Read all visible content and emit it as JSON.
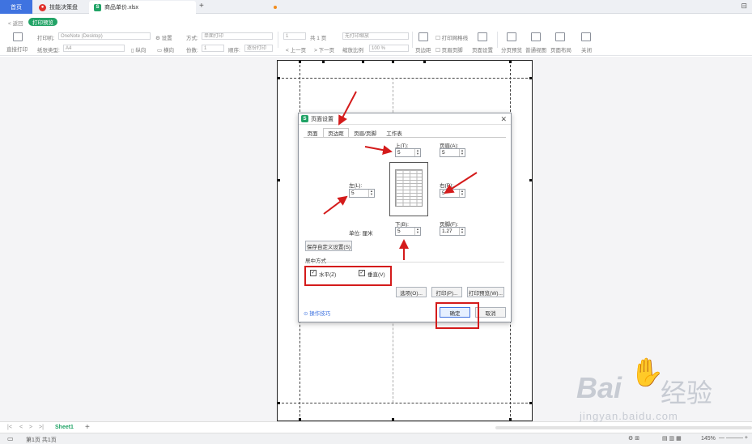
{
  "tabs": {
    "home": "首页",
    "doc1": "技能决策盘",
    "doc2": "商品单价.xlsx"
  },
  "toolbar": {
    "back": "< 返回",
    "mode_tag": "打印预览",
    "direct_print": "直接打印",
    "printer_label": "打印机:",
    "printer_value": "OneNote (Desktop)",
    "settings": "设置",
    "paper_type_label": "纸张类型:",
    "paper_type_value": "A4",
    "portrait": "纵向",
    "landscape": "横向",
    "method_label": "方式:",
    "method_value": "单面打印",
    "copies_label": "份数:",
    "copies_value": "1",
    "order_label": "顺序:",
    "order_value": "逐份打印",
    "page_value": "1",
    "page_total": "共 1 页",
    "prev": "上一页",
    "next": "下一页",
    "scale_value": "无打印缩放",
    "zoom_label": "缩放比例",
    "zoom_value": "100 %",
    "margins_btn": "页边距",
    "print_gridlines": "打印网格线",
    "header_footer": "页眉页脚",
    "page_setup": "页面设置",
    "page_break": "分页预览",
    "normal_view": "普通视图",
    "page_layout": "页面布局",
    "close": "关闭"
  },
  "dialog": {
    "title": "页面设置",
    "tabs": [
      "页面",
      "页边距",
      "页眉/页脚",
      "工作表"
    ],
    "top_label": "上(T):",
    "top_value": "5",
    "header_label": "页眉(A):",
    "header_value": "5",
    "left_label": "左(L):",
    "left_value": "5",
    "right_label": "右(R):",
    "right_value": "5",
    "bottom_label": "下(B):",
    "bottom_value": "5",
    "footer_label": "页脚(F):",
    "footer_value": "1.27",
    "unit_label": "单位: 厘米",
    "save_custom": "保存自定义设置(S)",
    "center_label": "居中方式",
    "horizontal": "水平(Z)",
    "vertical": "垂直(V)",
    "options_btn": "选项(O)...",
    "print_btn": "打印(P)...",
    "print_preview_btn": "打印预览(W)...",
    "tips": "操作技巧",
    "ok": "确定",
    "cancel": "取消"
  },
  "sheetbar": {
    "sheet_name": "Sheet1"
  },
  "statusbar": {
    "page_info": "第1页 共1页",
    "zoom": "145%"
  },
  "watermark": {
    "brand": "Bai",
    "brand2": "经验",
    "url": "jingyan.baidu.com"
  },
  "colors": {
    "accent_blue": "#3f73e0",
    "green": "#21a366",
    "annotation_red": "#d41b1b"
  }
}
